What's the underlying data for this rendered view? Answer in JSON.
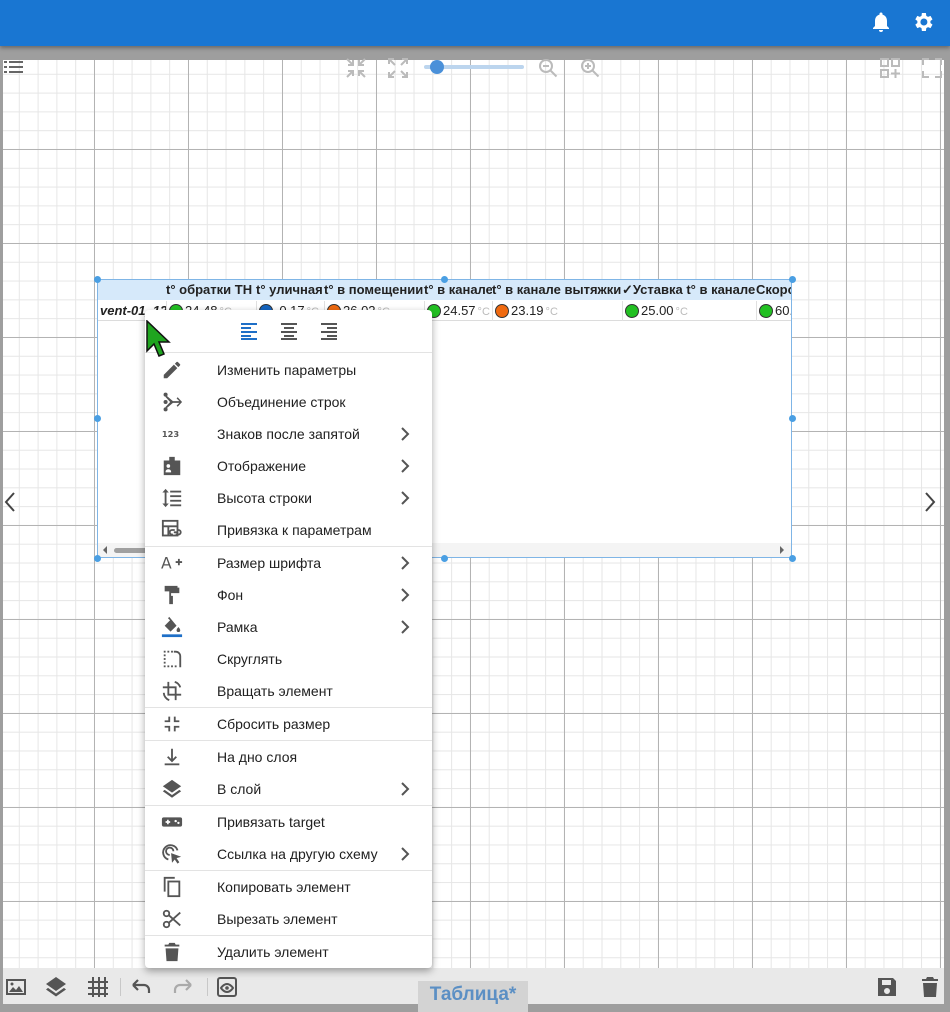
{
  "colors": {
    "topbar": "#1976d2",
    "accent": "#4a90d9",
    "title": "#5b8fc4"
  },
  "topbar": {
    "icons": [
      "bell-icon",
      "gear-icon"
    ]
  },
  "canvas_toolbar": {
    "icons": [
      "list-icon",
      "collapse-icon",
      "expand-icon",
      "zoom-out-icon",
      "zoom-in-icon",
      "add-grid-icon",
      "fullscreen-icon"
    ],
    "zoom_level": 0.1
  },
  "table": {
    "headers": [
      "t° обратки ТН",
      "t° уличная",
      "t° в помещении",
      "t° в канале",
      "t° в канале вытяжки",
      "✓Уставка t° в канале",
      "Скоро"
    ],
    "row": {
      "label": "vent-01_12",
      "cells": [
        {
          "value": "24.48",
          "unit": "°C",
          "color": "#22c022"
        },
        {
          "value": "-0.17",
          "unit": "°C",
          "color": "#1565c0"
        },
        {
          "value": "26.02",
          "unit": "°C",
          "color": "#f06a10"
        },
        {
          "value": "24.57",
          "unit": "°C",
          "color": "#22c022"
        },
        {
          "value": "23.19",
          "unit": "°C",
          "color": "#f06a10"
        },
        {
          "value": "25.00",
          "unit": "°C",
          "color": "#22c022"
        },
        {
          "value": "60.",
          "unit": "",
          "color": "#22c022"
        }
      ]
    }
  },
  "menu": {
    "alignment": [
      "align-left-icon",
      "align-center-icon",
      "align-right-icon"
    ],
    "items": [
      {
        "label": "Изменить параметры",
        "icon": "pencil-icon",
        "submenu": false
      },
      {
        "label": "Объединение строк",
        "icon": "merge-icon",
        "submenu": false
      },
      {
        "label": "Знаков после запятой",
        "icon": "numeric-icon",
        "submenu": true
      },
      {
        "label": "Отображение",
        "icon": "badge-icon",
        "submenu": true
      },
      {
        "label": "Высота строки",
        "icon": "line-height-icon",
        "submenu": true
      },
      {
        "label": "Привязка к параметрам",
        "icon": "link-table-icon",
        "submenu": false
      },
      {
        "label": "Размер шрифта",
        "icon": "font-size-icon",
        "submenu": true
      },
      {
        "label": "Фон",
        "icon": "paint-roller-icon",
        "submenu": true
      },
      {
        "label": "Рамка",
        "icon": "fill-bucket-icon",
        "submenu": true
      },
      {
        "label": "Скруглять",
        "icon": "rounded-corner-icon",
        "submenu": false
      },
      {
        "label": "Вращать элемент",
        "icon": "rotate-icon",
        "submenu": false
      },
      {
        "label": "Сбросить размер",
        "icon": "shrink-icon",
        "submenu": false
      },
      {
        "label": "На дно слоя",
        "icon": "arrow-bottom-icon",
        "submenu": false
      },
      {
        "label": "В слой",
        "icon": "layers-icon",
        "submenu": true
      },
      {
        "label": "Привязать target",
        "icon": "target-pad-icon",
        "submenu": false
      },
      {
        "label": "Ссылка на другую схему",
        "icon": "cursor-click-icon",
        "submenu": true
      },
      {
        "label": "Копировать элемент",
        "icon": "copy-icon",
        "submenu": false
      },
      {
        "label": "Вырезать элемент",
        "icon": "scissors-icon",
        "submenu": false
      },
      {
        "label": "Удалить элемент",
        "icon": "trash-icon",
        "submenu": false
      }
    ]
  },
  "bottombar": {
    "title": "Таблица*",
    "icons": [
      "image-icon",
      "layers-icon",
      "grid-icon",
      "undo-icon",
      "redo-icon",
      "preview-icon",
      "save-icon",
      "delete-icon"
    ]
  }
}
